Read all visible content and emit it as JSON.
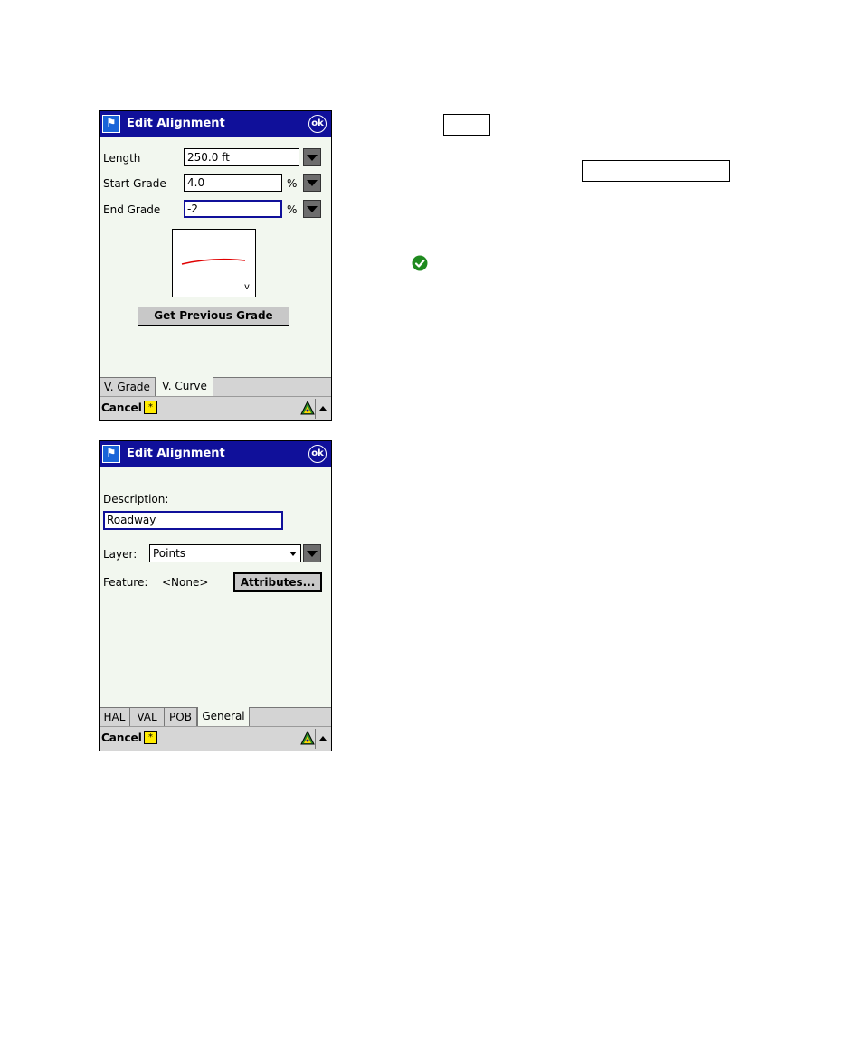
{
  "screen1": {
    "title": "Edit Alignment",
    "ok_label": "ok",
    "length_label": "Length",
    "length_value": "250.0 ft",
    "start_grade_label": "Start Grade",
    "start_grade_value": "4.0",
    "end_grade_label": "End Grade",
    "end_grade_value": "-2",
    "percent_symbol": "%",
    "preview_marker": "v",
    "get_previous_grade_label": "Get Previous Grade",
    "tabs": [
      {
        "label": "V. Grade",
        "active": false
      },
      {
        "label": "V. Curve",
        "active": true
      }
    ],
    "cancel_label": "Cancel",
    "sip_label": "*"
  },
  "screen2": {
    "title": "Edit Alignment",
    "ok_label": "ok",
    "description_label": "Description:",
    "description_value": "Roadway",
    "layer_label": "Layer:",
    "layer_value": "Points",
    "feature_label": "Feature:",
    "feature_value": "<None>",
    "attributes_label": "Attributes...",
    "tabs": [
      {
        "label": "HAL",
        "active": false
      },
      {
        "label": "VAL",
        "active": false
      },
      {
        "label": "POB",
        "active": false
      },
      {
        "label": "General",
        "active": true
      }
    ],
    "cancel_label": "Cancel",
    "sip_label": "*"
  },
  "colors": {
    "titlebar": "#10109a",
    "screen_bg": "#f2f7ef",
    "curve": "#e00000",
    "check": "#1f8a1f",
    "sip": "#ffeb00"
  }
}
